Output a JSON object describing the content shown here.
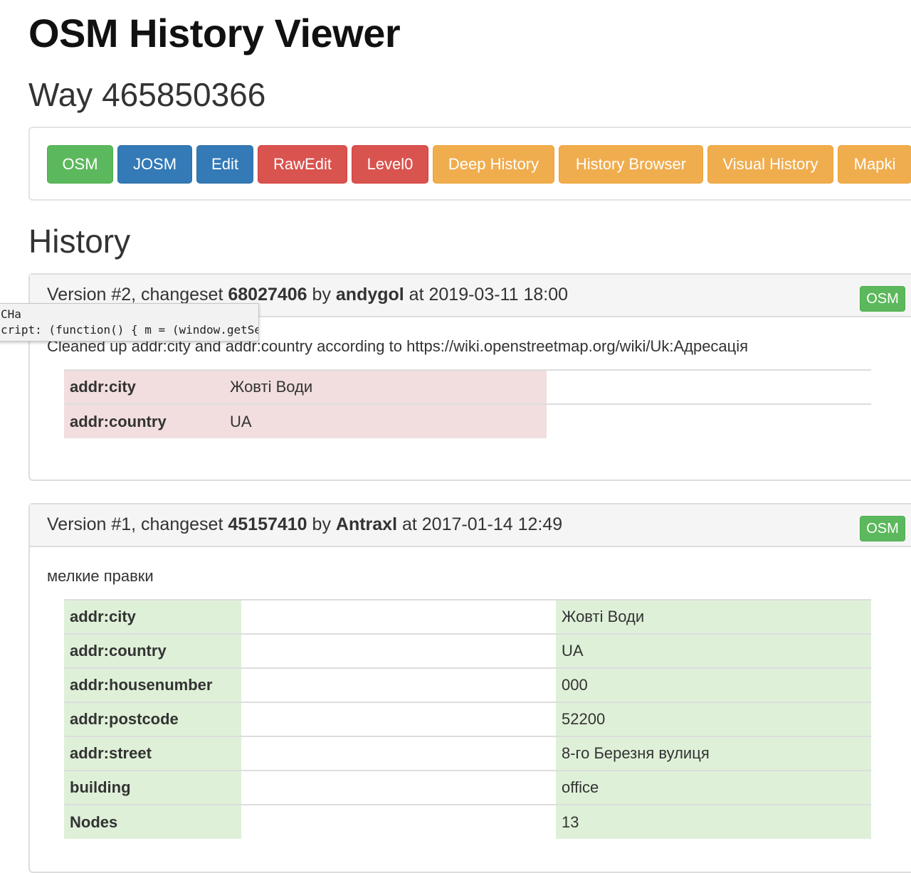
{
  "header": {
    "app_title": "OSM History Viewer",
    "object_title": "Way 465850366"
  },
  "toolbar": {
    "buttons": [
      {
        "label": "OSM",
        "color": "#5cb85c"
      },
      {
        "label": "JOSM",
        "color": "#337ab7"
      },
      {
        "label": "Edit",
        "color": "#337ab7"
      },
      {
        "label": "RawEdit",
        "color": "#d9534f"
      },
      {
        "label": "Level0",
        "color": "#d9534f"
      },
      {
        "label": "Deep History",
        "color": "#f0ad4e"
      },
      {
        "label": "History Browser",
        "color": "#f0ad4e"
      },
      {
        "label": "Visual History",
        "color": "#f0ad4e"
      },
      {
        "label": "Mapki",
        "color": "#f0ad4e"
      }
    ]
  },
  "history": {
    "title": "History",
    "versions": [
      {
        "version_prefix": "Version #2, changeset ",
        "changeset": "68027406",
        "by": " by ",
        "user": "andygol",
        "at": " at ",
        "timestamp": "2019-03-11 18:00",
        "osm_button": "OSM",
        "comment": "Cleaned up addr:city and addr:country according to https://wiki.openstreetmap.org/wiki/Uk:Адресація",
        "tags": [
          {
            "key": "addr:city",
            "old": "Жовті Води",
            "new": ""
          },
          {
            "key": "addr:country",
            "old": "UA",
            "new": ""
          }
        ]
      },
      {
        "version_prefix": "Version #1, changeset ",
        "changeset": "45157410",
        "by": " by ",
        "user": "Antraxl",
        "at": " at ",
        "timestamp": "2017-01-14 12:49",
        "osm_button": "OSM",
        "comment": "мелкие правки",
        "tags": [
          {
            "key": "addr:city",
            "old": "",
            "new": "Жовті Води"
          },
          {
            "key": "addr:country",
            "old": "",
            "new": "UA"
          },
          {
            "key": "addr:housenumber",
            "old": "",
            "new": "000"
          },
          {
            "key": "addr:postcode",
            "old": "",
            "new": "52200"
          },
          {
            "key": "addr:street",
            "old": "",
            "new": "8-го Березня вулиця"
          },
          {
            "key": "building",
            "old": "",
            "new": "office"
          },
          {
            "key": "Nodes",
            "old": "",
            "new": "13"
          }
        ]
      }
    ]
  },
  "tooltip": {
    "line1": "CHa",
    "line2": "cript: (function() { m = (window.getSelec..."
  }
}
